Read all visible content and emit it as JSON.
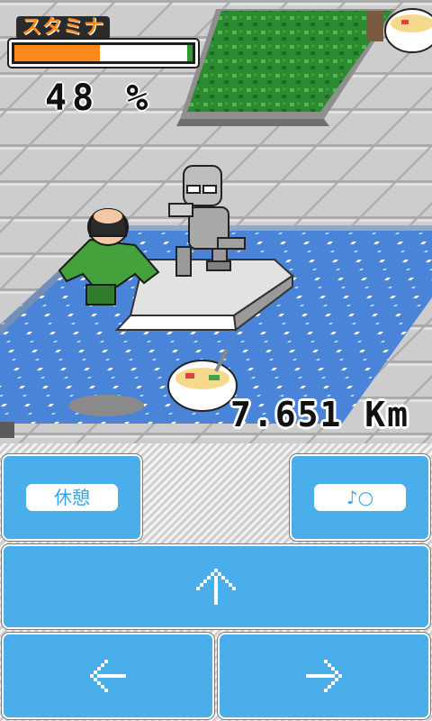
{
  "hud": {
    "stamina_label": "スタミナ",
    "stamina_level": 0.48,
    "stamina_percent_text": "48 %",
    "distance_text": "7.651 Km"
  },
  "controls": {
    "rest_label": "休憩",
    "sound_label": "♪○"
  },
  "icons": {
    "forward": "up-arrow-icon",
    "left": "left-arrow-icon",
    "right": "right-arrow-icon"
  },
  "colors": {
    "button_blue": "#49aeea",
    "stamina_orange": "#ff8a1c",
    "water_blue": "#4a84d8"
  }
}
